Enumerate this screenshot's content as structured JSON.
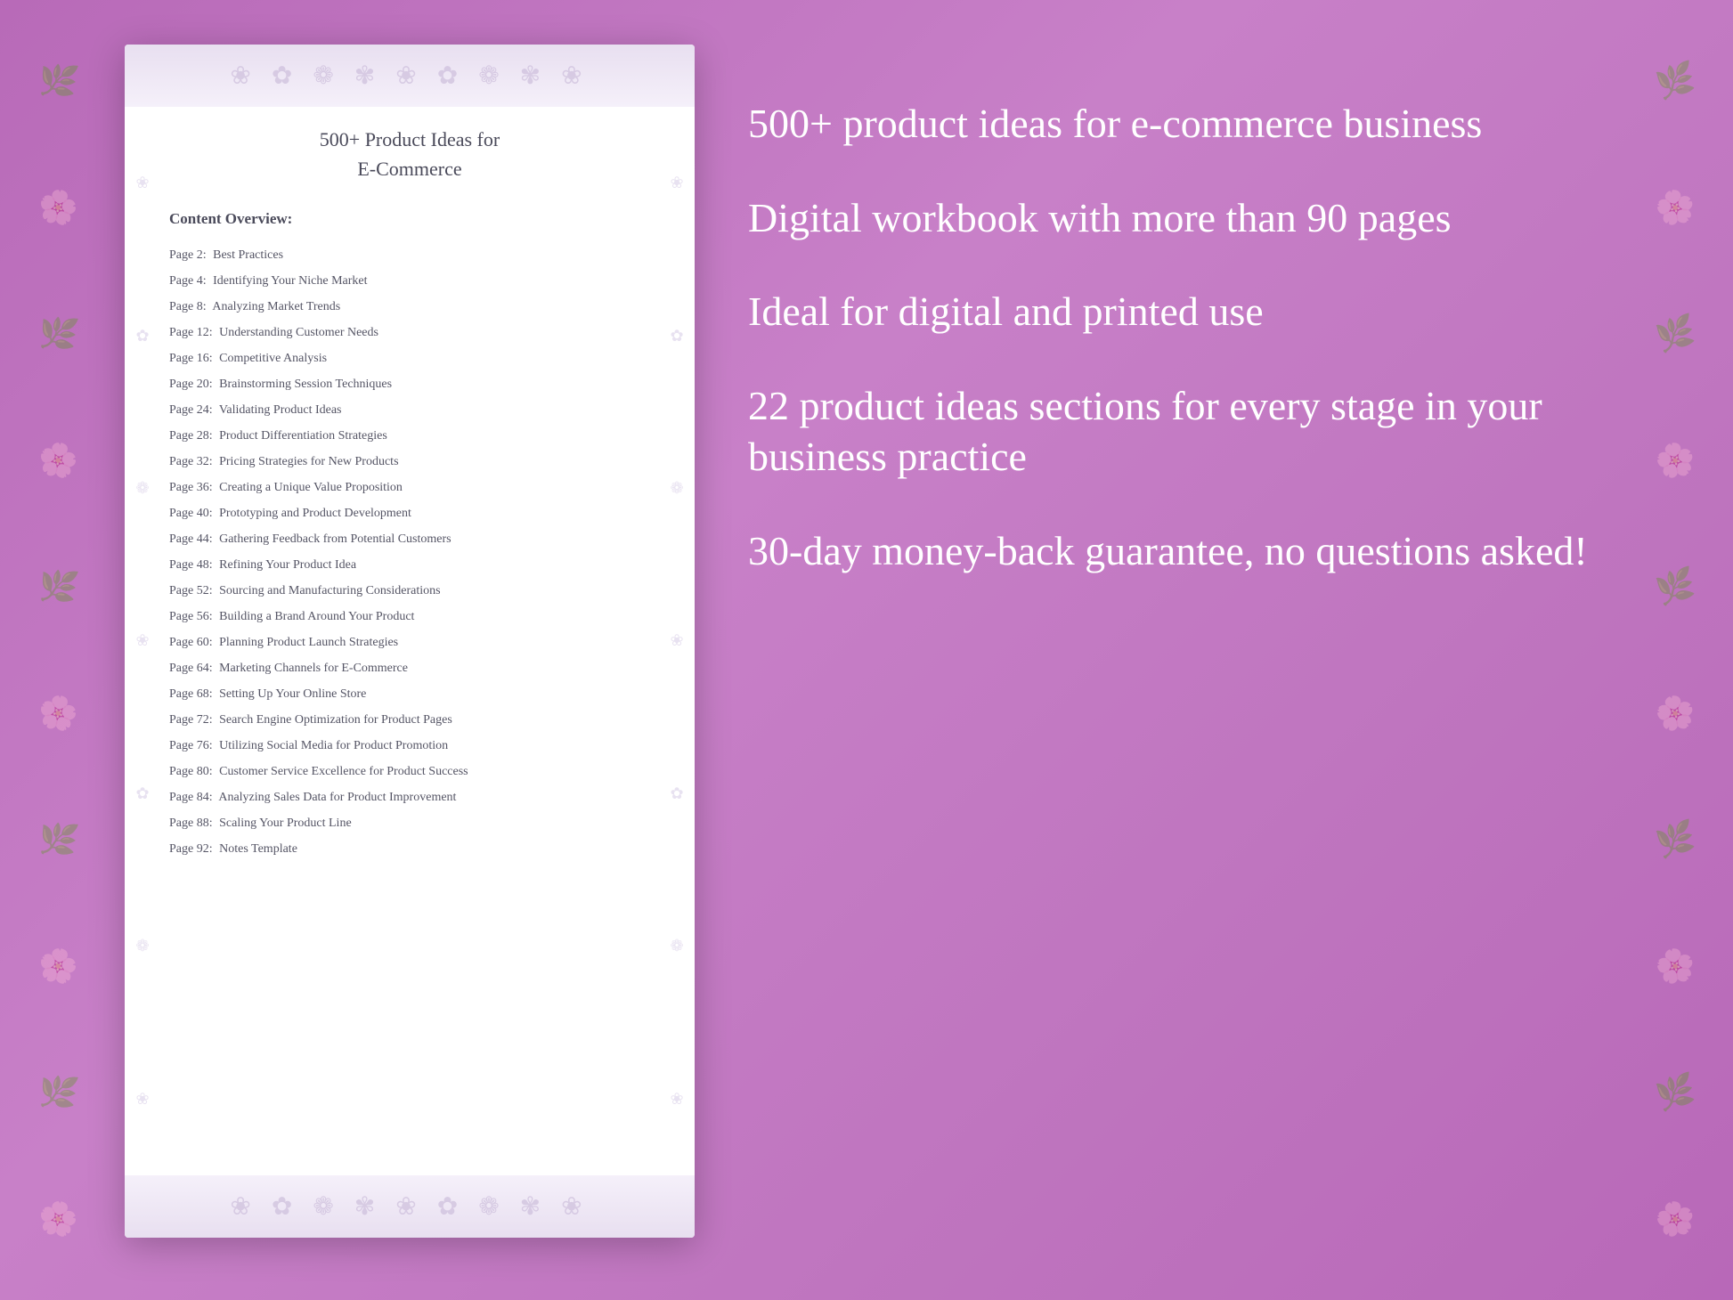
{
  "background": {
    "color": "#c07fc0"
  },
  "document": {
    "title_line1": "500+ Product Ideas for",
    "title_line2": "E-Commerce",
    "section_label": "Content Overview:",
    "toc_items": [
      {
        "page": "Page  2:",
        "title": "Best Practices"
      },
      {
        "page": "Page  4:",
        "title": "Identifying Your Niche Market"
      },
      {
        "page": "Page  8:",
        "title": "Analyzing Market Trends"
      },
      {
        "page": "Page 12:",
        "title": "Understanding Customer Needs"
      },
      {
        "page": "Page 16:",
        "title": "Competitive Analysis"
      },
      {
        "page": "Page 20:",
        "title": "Brainstorming Session Techniques"
      },
      {
        "page": "Page 24:",
        "title": "Validating Product Ideas"
      },
      {
        "page": "Page 28:",
        "title": "Product Differentiation Strategies"
      },
      {
        "page": "Page 32:",
        "title": "Pricing Strategies for New Products"
      },
      {
        "page": "Page 36:",
        "title": "Creating a Unique Value Proposition"
      },
      {
        "page": "Page 40:",
        "title": "Prototyping and Product Development"
      },
      {
        "page": "Page 44:",
        "title": "Gathering Feedback from Potential Customers"
      },
      {
        "page": "Page 48:",
        "title": "Refining Your Product Idea"
      },
      {
        "page": "Page 52:",
        "title": "Sourcing and Manufacturing Considerations"
      },
      {
        "page": "Page 56:",
        "title": "Building a Brand Around Your Product"
      },
      {
        "page": "Page 60:",
        "title": "Planning Product Launch Strategies"
      },
      {
        "page": "Page 64:",
        "title": "Marketing Channels for E-Commerce"
      },
      {
        "page": "Page 68:",
        "title": "Setting Up Your Online Store"
      },
      {
        "page": "Page 72:",
        "title": "Search Engine Optimization for Product Pages"
      },
      {
        "page": "Page 76:",
        "title": "Utilizing Social Media for Product Promotion"
      },
      {
        "page": "Page 80:",
        "title": "Customer Service Excellence for Product Success"
      },
      {
        "page": "Page 84:",
        "title": "Analyzing Sales Data for Product Improvement"
      },
      {
        "page": "Page 88:",
        "title": "Scaling Your Product Line"
      },
      {
        "page": "Page 92:",
        "title": "Notes Template"
      }
    ]
  },
  "info_panel": {
    "bullets": [
      "500+ product ideas for\ne-commerce business",
      "Digital workbook with\nmore than 90 pages",
      "Ideal for digital and\nprinted use",
      "22 product ideas\nsections for every stage\nin your business\npractice",
      "30-day money-back\nguarantee, no\nquestions asked!"
    ]
  },
  "floral_symbol": "❀",
  "floral_sprig_symbols": [
    "✿",
    "❁",
    "✾",
    "❀",
    "✿",
    "❁",
    "✾",
    "❀",
    "✿",
    "❁",
    "✾",
    "❀"
  ]
}
